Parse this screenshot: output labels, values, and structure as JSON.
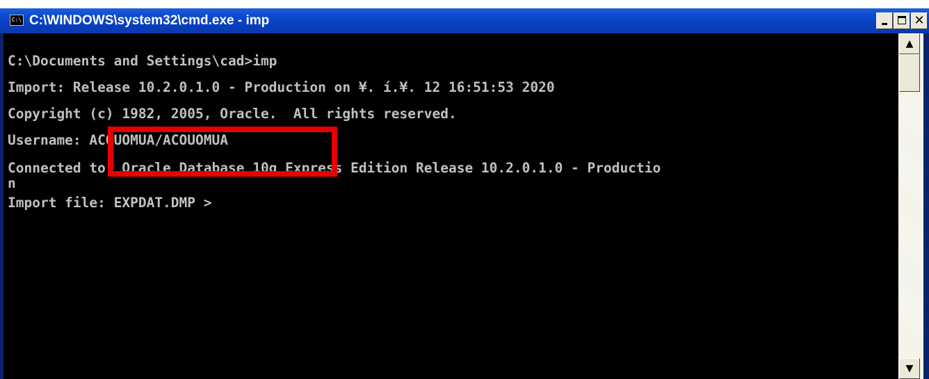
{
  "window": {
    "title": "C:\\WINDOWS\\system32\\cmd.exe - imp",
    "icon_label": "C:\\",
    "controls": {
      "minimize": "minimize-icon",
      "maximize": "maximize-icon",
      "close_label": "✕"
    }
  },
  "console": {
    "lines": [
      "C:\\Documents and Settings\\cad>imp",
      "Import: Release 10.2.0.1.0 - Production on ¥. í.¥. 12 16:51:53 2020",
      "Copyright (c) 1982, 2005, Oracle.  All rights reserved.",
      "Username: ACOUOMUA/ACOUOMUA",
      "Connected to: Oracle Database 10g Express Edition Release 10.2.0.1.0 - Productio",
      "n",
      "Import file: EXPDAT.DMP >"
    ]
  },
  "annotation": {
    "highlight_color": "#e60000"
  },
  "scrollbar": {
    "up_arrow": "▲",
    "down_arrow": "▼"
  }
}
